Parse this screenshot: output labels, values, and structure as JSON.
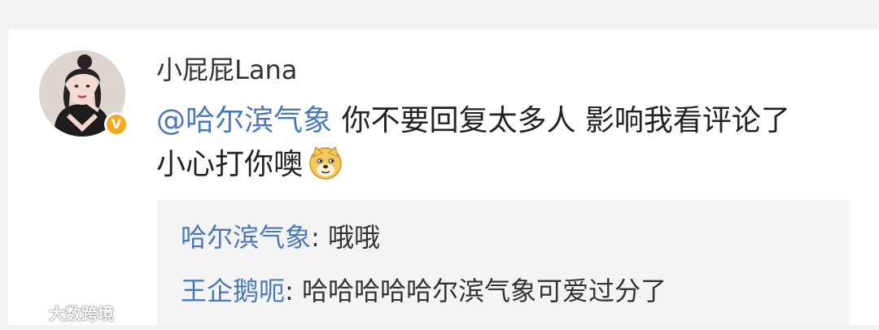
{
  "comment": {
    "username": "小屁屁Lana",
    "mention": "@哈尔滨气象",
    "text_line1": " 你不要回复太多人 影响我看评论了",
    "text_line2": "小心打你噢",
    "emoji": "doge-icon",
    "verified_badge": "V"
  },
  "replies": [
    {
      "author": "哈尔滨气象",
      "separator": ": ",
      "text": "哦哦"
    },
    {
      "author": "王企鹅呃",
      "separator": ": ",
      "text": "哈哈哈哈哈尔滨气象可爱过分了"
    }
  ],
  "watermark": {
    "text": "大数跨境"
  },
  "colors": {
    "link": "#4a78b8",
    "badge": "#f6a91c",
    "text": "#222222"
  }
}
